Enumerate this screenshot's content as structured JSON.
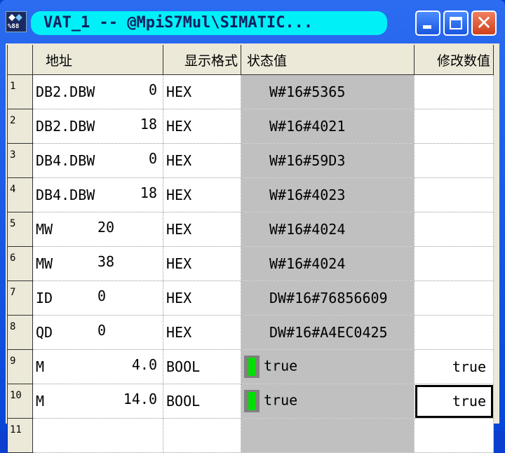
{
  "window": {
    "title": "VAT_1 -- @MpiS7Mul\\SIMATIC..."
  },
  "columns": {
    "address": "地址",
    "format": "显示格式",
    "status": "状态值",
    "modify": "修改数值"
  },
  "rows": [
    {
      "n": "1",
      "addr": "DB2.DBW",
      "off": "0",
      "fmt": "HEX",
      "status": "W#16#5365",
      "modify": ""
    },
    {
      "n": "2",
      "addr": "DB2.DBW",
      "off": "18",
      "fmt": "HEX",
      "status": "W#16#4021",
      "modify": ""
    },
    {
      "n": "3",
      "addr": "DB4.DBW",
      "off": "0",
      "fmt": "HEX",
      "status": "W#16#59D3",
      "modify": ""
    },
    {
      "n": "4",
      "addr": "DB4.DBW",
      "off": "18",
      "fmt": "HEX",
      "status": "W#16#4023",
      "modify": ""
    },
    {
      "n": "5",
      "addr": "MW",
      "off": "20",
      "fmt": "HEX",
      "status": "W#16#4024",
      "modify": ""
    },
    {
      "n": "6",
      "addr": "MW",
      "off": "38",
      "fmt": "HEX",
      "status": "W#16#4024",
      "modify": ""
    },
    {
      "n": "7",
      "addr": "ID",
      "off": "0",
      "fmt": "HEX",
      "status": "DW#16#76856609",
      "modify": ""
    },
    {
      "n": "8",
      "addr": "QD",
      "off": "0",
      "fmt": "HEX",
      "status": "DW#16#A4EC0425",
      "modify": ""
    },
    {
      "n": "9",
      "addr": "M",
      "off": "4.0",
      "fmt": "BOOL",
      "status": "true",
      "modify": "true"
    },
    {
      "n": "10",
      "addr": "M",
      "off": "14.0",
      "fmt": "BOOL",
      "status": "true",
      "modify": "true"
    },
    {
      "n": "11",
      "addr": "",
      "off": "",
      "fmt": "",
      "status": "",
      "modify": ""
    }
  ],
  "colors": {
    "led_on": "#00e000",
    "status_bg": "#c0c0c0",
    "title_pill": "#00f0f8"
  }
}
